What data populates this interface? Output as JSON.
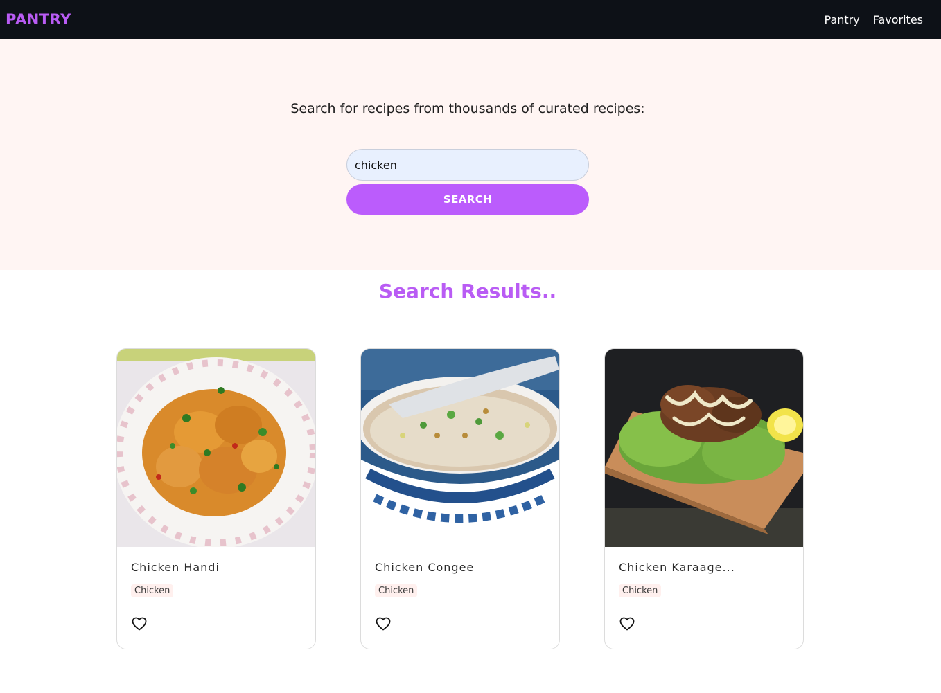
{
  "nav": {
    "brand": "PANTRY",
    "links": [
      "Pantry",
      "Favorites"
    ]
  },
  "hero": {
    "prompt": "Search for recipes from thousands of curated recipes:",
    "search_value": "chicken",
    "search_button": "SEARCH"
  },
  "results": {
    "title": "Search Results..",
    "cards": [
      {
        "title": "Chicken Handi",
        "tag": "Chicken",
        "favorite_icon": "heart-outline-icon"
      },
      {
        "title": "Chicken Congee",
        "tag": "Chicken",
        "favorite_icon": "heart-outline-icon"
      },
      {
        "title": "Chicken Karaage...",
        "tag": "Chicken",
        "favorite_icon": "heart-outline-icon"
      }
    ]
  },
  "colors": {
    "navbar_bg": "#0d1117",
    "brand": "#b95cf4",
    "hero_bg": "#fff5f3",
    "button": "#bb5cfc",
    "input_bg": "#e8f0fe"
  }
}
